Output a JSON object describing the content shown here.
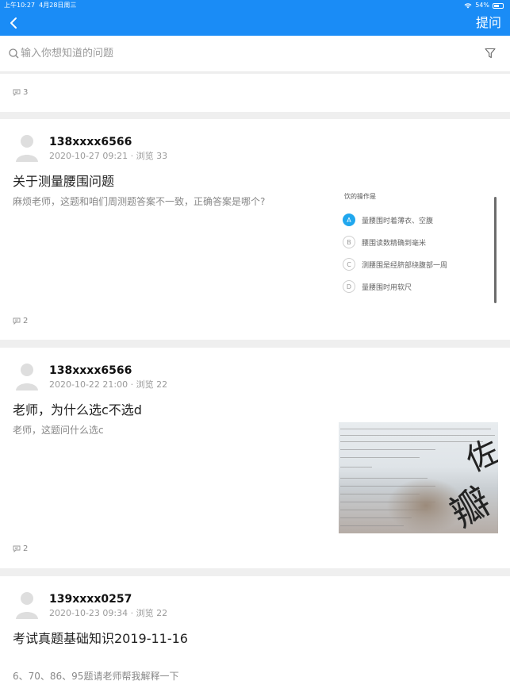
{
  "status_bar": {
    "time": "上午10:27",
    "date": "4月28日周三",
    "battery": "54%"
  },
  "nav": {
    "back_icon": "chevron-left-icon",
    "ask_label": "提问"
  },
  "search": {
    "placeholder": "输入你想知道的问题"
  },
  "partial_card": {
    "comment_count": "3"
  },
  "posts": [
    {
      "username": "138xxxx6566",
      "datetime": "2020-10-27 09:21",
      "views": "浏览 33",
      "title": "关于测量腰围问题",
      "description": "麻烦老师，这题和咱们周测题答案不一致，正确答案是哪个?",
      "comment_count": "2",
      "image": {
        "header": "饮的操作是",
        "options": [
          {
            "letter": "A",
            "text": "量腰围时着薄衣、空腹",
            "selected": true
          },
          {
            "letter": "B",
            "text": "腰围读数精确到毫米",
            "selected": false
          },
          {
            "letter": "C",
            "text": "测腰围是经脐部绕腹部一周",
            "selected": false
          },
          {
            "letter": "D",
            "text": "量腰围时用软尺",
            "selected": false
          }
        ]
      }
    },
    {
      "username": "138xxxx6566",
      "datetime": "2020-10-22 21:00",
      "views": "浏览 22",
      "title": "老师，为什么选c不选d",
      "description": "老师，这题问什么选c",
      "comment_count": "2"
    },
    {
      "username": "139xxxx0257",
      "datetime": "2020-10-23 09:34",
      "views": "浏览 22",
      "title": "考试真题基础知识2019-11-16",
      "description": "6、70、86、95题请老师帮我解释一下"
    }
  ],
  "colors": {
    "primary": "#1a8cf6",
    "accent_option": "#20a7ee"
  }
}
